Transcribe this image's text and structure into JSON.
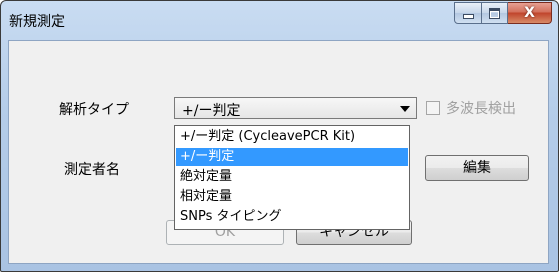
{
  "window": {
    "title": "新規測定",
    "buttons": {
      "minimize_icon": "minimize-icon",
      "maximize_icon": "maximize-icon",
      "close_glyph": "X"
    }
  },
  "form": {
    "analysis_type_label": "解析タイプ",
    "analysis_type_selected": "+/ー判定",
    "multi_wavelength_label": "多波長検出",
    "multi_wavelength_checked": false,
    "multi_wavelength_enabled": false,
    "measurer_label": "測定者名",
    "edit_button_label": "編集"
  },
  "dropdown": {
    "options": [
      "+/ー判定 (CycleavePCR Kit)",
      "+/ー判定",
      "絶対定量",
      "相対定量",
      "SNPs タイピング"
    ],
    "highlighted_index": 1
  },
  "footer": {
    "ok_label": "OK",
    "cancel_label": "キャンセル"
  },
  "colors": {
    "highlight": "#3399ff",
    "window_frame": "#b5cde9",
    "close_button": "#c0452c"
  }
}
